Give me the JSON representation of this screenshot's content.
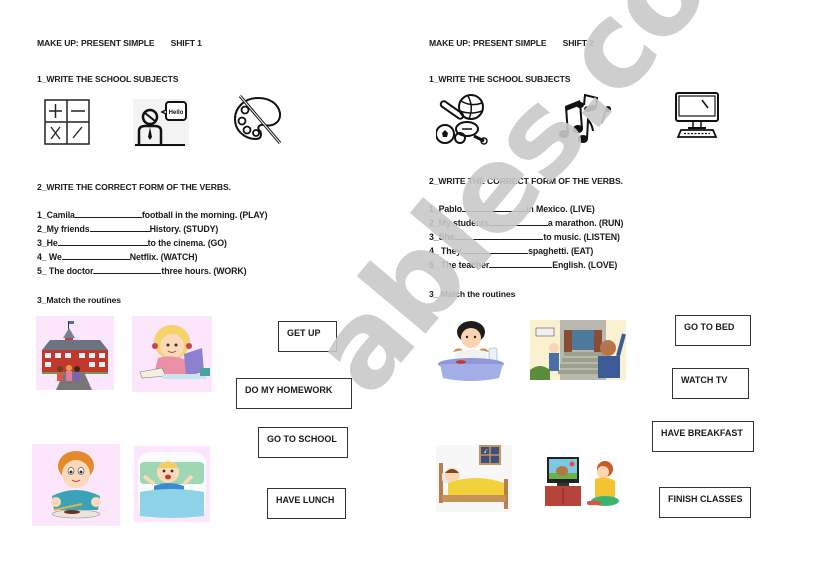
{
  "shift1": {
    "title": "MAKE UP: PRESENT SIMPLE",
    "shift": "SHIFT 1",
    "section1_heading": "1_WRITE THE SCHOOL SUBJECTS",
    "subject_icons": [
      "math-icon",
      "english-icon",
      "art-icon"
    ],
    "section2_heading": "2_WRITE THE CORRECT FORM OF THE VERBS.",
    "sentences": [
      {
        "prefix": "1_Camila",
        "suffix": "football in the morning. (PLAY)"
      },
      {
        "prefix": "2_My friends",
        "suffix": "History. (STUDY)"
      },
      {
        "prefix": "3_He",
        "suffix": "to the cinema. (GO)"
      },
      {
        "prefix": "4_ We",
        "suffix": "Netflix. (WATCH)"
      },
      {
        "prefix": "5_ The doctor",
        "suffix": "three hours. (WORK)"
      }
    ],
    "section3_heading": "3_Match the routines",
    "routine_images": [
      "school-building-image",
      "girl-doing-homework-image",
      "boy-eating-lunch-image",
      "boy-waking-up-image"
    ],
    "routine_labels": [
      "GET UP",
      "DO MY HOMEWORK",
      "GO TO SCHOOL",
      "HAVE LUNCH"
    ]
  },
  "shift2": {
    "title": "MAKE UP: PRESENT SIMPLE",
    "shift": "SHIFT 2",
    "section1_heading": "1_WRITE THE SCHOOL SUBJECTS",
    "subject_icons": [
      "sports-icon",
      "music-icon",
      "computer-icon"
    ],
    "section2_heading": "2_WRITE THE CORRECT FORM OF THE VERBS.",
    "sentences": [
      {
        "prefix": "1_Pablo",
        "suffix": "in Mexico. (LIVE)"
      },
      {
        "prefix": "2_My students",
        "suffix": "a marathon. (RUN)"
      },
      {
        "prefix": "3_She",
        "suffix": "to music. (LISTEN)"
      },
      {
        "prefix": "4_ They",
        "suffix": "spaghetti. (EAT)"
      },
      {
        "prefix": "5_ The teacher",
        "suffix": "English. (LOVE)"
      }
    ],
    "section3_heading": "3_ Match the routines",
    "routine_images": [
      "boy-having-breakfast-image",
      "leaving-school-image",
      "boy-sleeping-image",
      "boy-watching-tv-image"
    ],
    "routine_labels": [
      "GO TO BED",
      "WATCH TV",
      "HAVE BREAKFAST",
      "FINISH CLASSES"
    ]
  },
  "watermark": "ables.com",
  "colors": {
    "image_background": "#fbe6fb",
    "watermark": "#c9c9c9",
    "text": "#1a1a1a"
  }
}
